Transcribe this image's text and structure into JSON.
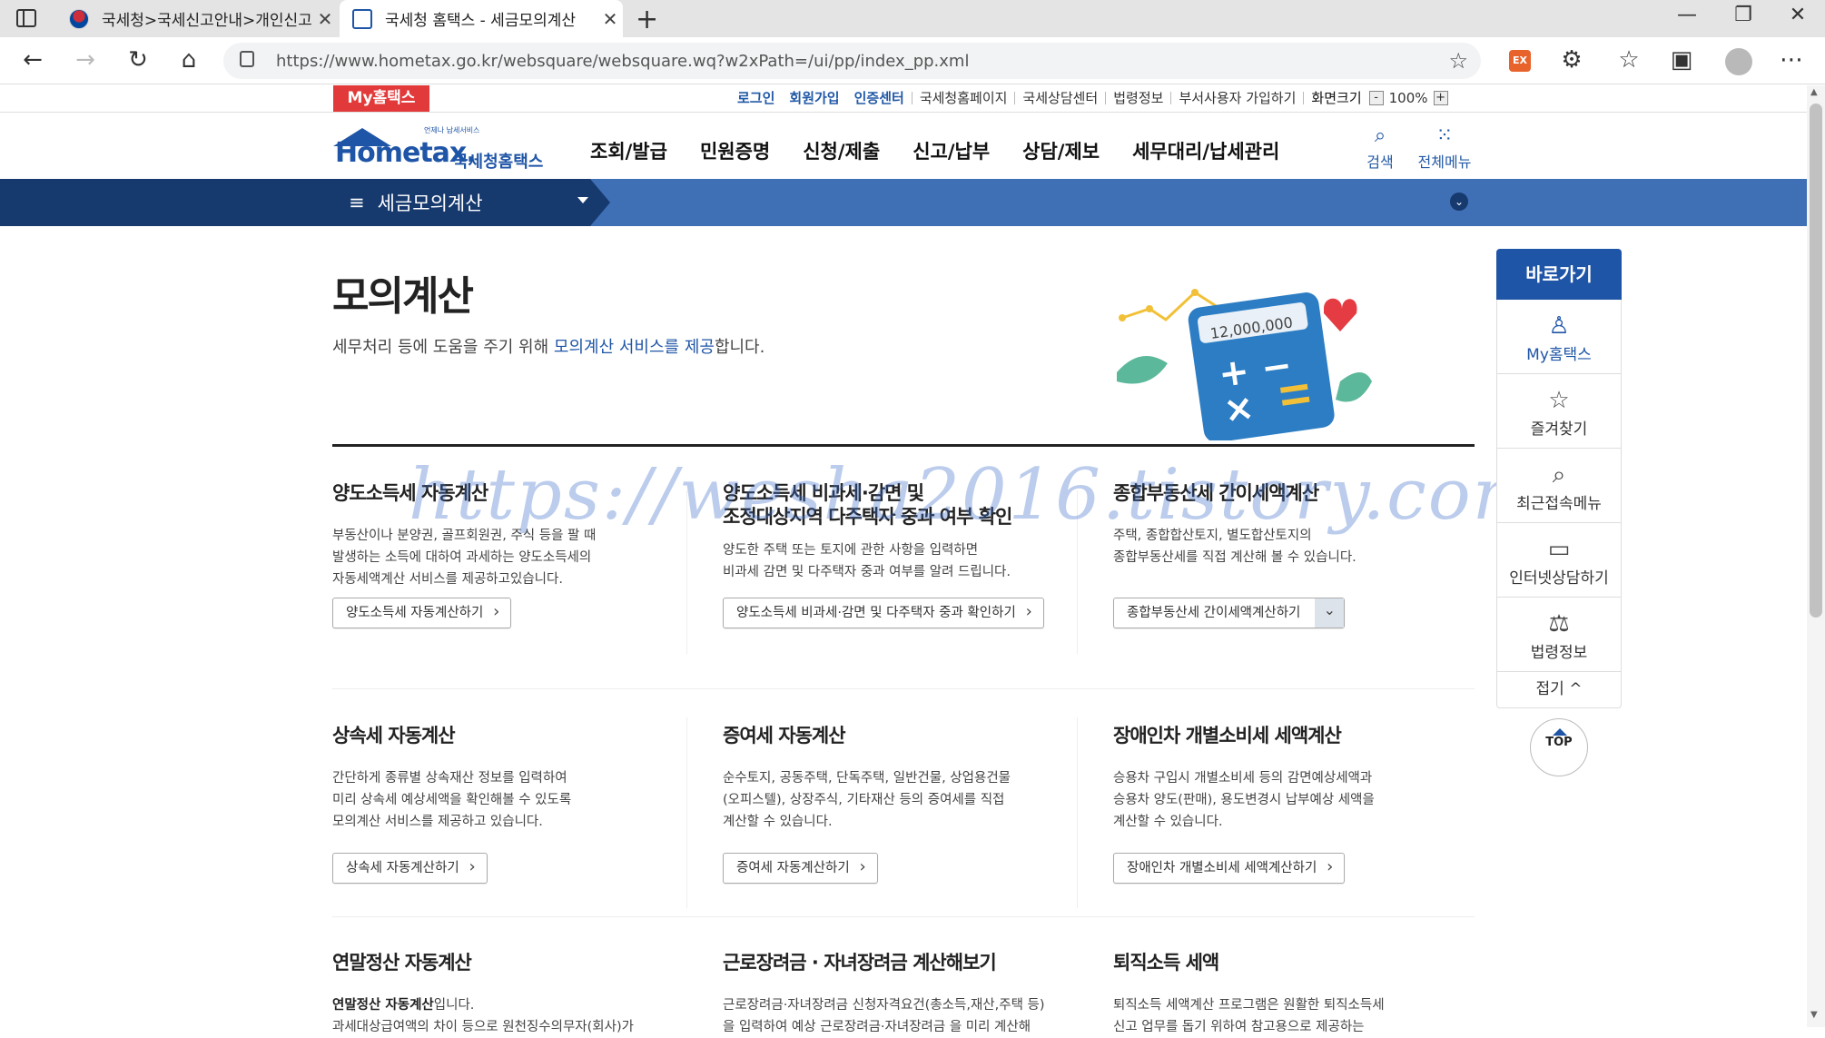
{
  "browser": {
    "tabs": [
      {
        "title": "국세청>국세신고안내>개인신고"
      },
      {
        "title": "국세청 홈택스 - 세금모의계산"
      }
    ],
    "url": "https://www.hometax.go.kr/websquare/websquare.wq?w2xPath=/ui/pp/index_pp.xml",
    "ext_label": "EX"
  },
  "util": {
    "my_hometax": "My홈택스",
    "links": [
      "로그인",
      "회원가입",
      "인증센터",
      "국세청홈페이지",
      "국세상담센터",
      "법령정보",
      "부서사용자 가입하기",
      "화면크기"
    ],
    "zoom": "100%",
    "zoom_minus": "-",
    "zoom_plus": "+"
  },
  "header": {
    "logo_word": "Hometax.",
    "logo_sub": "국세청홈택스",
    "logo_tag": "언제나 납세서비스",
    "gnb": [
      "조회/발급",
      "민원증명",
      "신청/제출",
      "신고/납부",
      "상담/제보",
      "세무대리/납세관리"
    ],
    "search_label": "검색",
    "allmenu_label": "전체메뉴"
  },
  "band": {
    "menu_title": "세금모의계산"
  },
  "page": {
    "title": "모의계산",
    "desc_pre": "세무처리 등에 도움을 주기 위해 ",
    "desc_em": "모의계산 서비스를 제공",
    "desc_post": "합니다.",
    "hero_amount": "12,000,000"
  },
  "cards": [
    {
      "title": "양도소득세 자동계산",
      "text": "부동산이나 분양권, 골프회원권, 주식 등을 팔 때\n발생하는 소득에 대하여 과세하는 양도소득세의\n자동세액계산 서비스를 제공하고있습니다.",
      "button": "양도소득세 자동계산하기"
    },
    {
      "title": "양도소득세 비과세·감면 및\n조정대상지역 다주택자 중과 여부 확인",
      "text": "양도한 주택 또는 토지에 관한 사항을 입력하면\n비과세 감면 및 다주택자 중과 여부를 알려 드립니다.",
      "button": "양도소득세 비과세·감면 및 다주택자 중과 확인하기"
    },
    {
      "title": "종합부동산세 간이세액계산",
      "text": "주택, 종합합산토지, 별도합산토지의\n종합부동산세를 직접 계산해 볼 수 있습니다.",
      "button": "종합부동산세 간이세액계산하기"
    },
    {
      "title": "상속세 자동계산",
      "text": "간단하게 종류별 상속재산 정보를 입력하여\n미리 상속세 예상세액을 확인해볼 수 있도록\n모의계산 서비스를 제공하고 있습니다.",
      "button": "상속세 자동계산하기"
    },
    {
      "title": "증여세 자동계산",
      "text": "순수토지, 공동주택, 단독주택, 일반건물, 상업용건물\n(오피스텔), 상장주식, 기타재산 등의 증여세를 직접\n계산할 수 있습니다.",
      "button": "증여세 자동계산하기"
    },
    {
      "title": "장애인차 개별소비세 세액계산",
      "text": "승용차 구입시 개별소비세 등의 감면예상세액과\n승용차 양도(판매), 용도변경시 납부예상 세액을\n계산할 수 있습니다.",
      "button": "장애인차 개별소비세 세액계산하기"
    },
    {
      "title": "연말정산 자동계산",
      "text_bold": "연말정산 자동계산",
      "text": "입니다.\n과세대상급여액의 차이 등으로 원천징수의무자(회사)가",
      "button": ""
    },
    {
      "title": "근로장려금 · 자녀장려금 계산해보기",
      "text": "근로장려금·자녀장려금 신청자격요건(총소득,재산,주택 등)\n을 입력하여 예상 근로장려금·자녀장려금 을 미리 계산해",
      "button": ""
    },
    {
      "title": "퇴직소득 세액",
      "text": "퇴직소득 세액계산 프로그램은 원활한 퇴직소득세\n신고 업무를 돕기 위하여 참고용으로 제공하는",
      "button": ""
    }
  ],
  "quick": {
    "head": "바로가기",
    "items": [
      "My홈택스",
      "즐겨찾기",
      "최근접속메뉴",
      "인터넷상담하기",
      "법령정보"
    ],
    "fold": "접기 ^",
    "top": "TOP"
  },
  "watermark": "https://wesha2016.tistory.com",
  "colors": {
    "brand": "#1f55a7",
    "band": "#3f6fb5",
    "band_dark": "#16396e",
    "my_red": "#e23a3a"
  }
}
